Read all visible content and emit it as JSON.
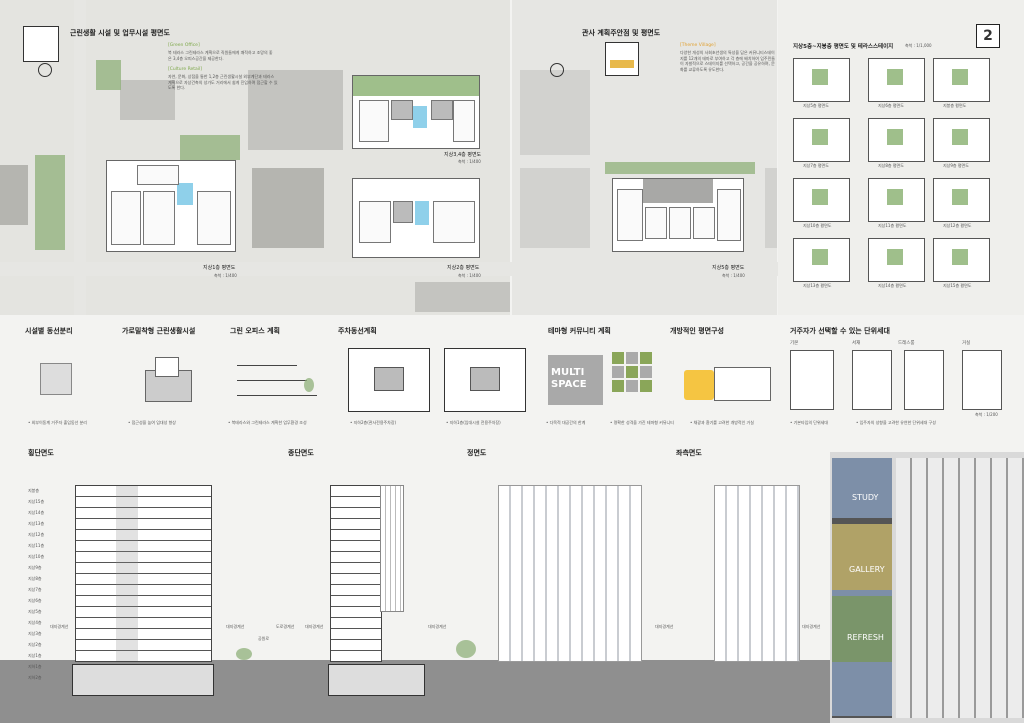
{
  "page_number": "2",
  "left_site": {
    "title": "근린생활 시설 및 업무시설 평면도",
    "green_office_tag": "[Green Office]",
    "green_office_text": "북 테라스 그린테라스 계획으로 직원들에게 쾌적하고 조망의 좋은 3,4층 오피스공간을 제공한다.",
    "culture_retail_tag": "[Culture Retail]",
    "culture_retail_text": "자연, 문화, 상점을 통한 1,2층 근린생활시설 외부계단과 테라스 계획으로 자상건축의 성가도 거리에서 쉽게 진입하며 접근할 수 있도록 한다.",
    "plan_1f_title": "지상1층 평면도",
    "plan_1f_scale": "축척 : 1/400",
    "plan_2f_title": "지상2층 평면도",
    "plan_2f_scale": "축척 : 1/400",
    "plan_34f_title": "지상3,4층 평면도",
    "plan_34f_scale": "축척 : 1/400"
  },
  "right_site": {
    "title": "관사 계획주안점 및 평면도",
    "theme_tag": "[Theme Village]",
    "theme_text": "다양한 개성의 사회초년생의 특성을 담은 커뮤니티스테이지를 12개의 테마로 부여하고 각 층에 배치하여 입주민들이 자발적으로 스테이지를 선택하고, 공간을 공유하며, 문화를 교류하도록 유도한다.",
    "plan_5f_title": "지상5층 평면도",
    "plan_5f_scale": "축척 : 1/400",
    "stage_title": "지상5층~지붕층 평면도 및 테라스스테이지",
    "stage_scale": "축척 : 1/1,000",
    "stages": [
      {
        "label": "지상5층 평면도"
      },
      {
        "label": "지상6층 평면도"
      },
      {
        "label": "지붕층 평면도"
      },
      {
        "label": "지상7층 평면도"
      },
      {
        "label": "지상8층 평면도"
      },
      {
        "label": "지상9층 평면도"
      },
      {
        "label": "지상10층 평면도"
      },
      {
        "label": "지상11층 평면도"
      },
      {
        "label": "지상12층 평면도"
      },
      {
        "label": "지상13층 평면도"
      },
      {
        "label": "지상14층 평면도"
      },
      {
        "label": "지상15층 평면도"
      }
    ]
  },
  "concepts_left": [
    {
      "title": "시설별 동선분리",
      "caption": "• 외부이동계 거주자 출입동선 분리"
    },
    {
      "title": "가로밀착형 근린생활시설",
      "caption": "• 접근성을 높여 임대성 향상"
    },
    {
      "title": "그린 오피스 계획",
      "caption": "• 북테라스와 그린테라스 계획한 업무환경 조성"
    },
    {
      "title": "주차동선계획",
      "caption": "• 지하2층(관사전용주차장)"
    },
    {
      "title": "",
      "caption": "• 지하1층(임대시설 전용주차장)"
    }
  ],
  "concepts_right": [
    {
      "title": "테마형 커뮤니티 계획",
      "caption": "• 다목적 대공간의 한계"
    },
    {
      "title": "",
      "caption": "• 명확한 성격을 가진 테마형 커뮤니티"
    },
    {
      "title": "개방적인 평면구성",
      "caption": "• 채광과 환기를 고려한 개방적인 거실"
    },
    {
      "title": "거주자가 선택할 수 있는 단위세대",
      "caption": "• 기본타입의 단위세대"
    },
    {
      "title": "",
      "caption": "• 입주자의 성향을 고려한 유연한 단위세대 구성"
    }
  ],
  "unit_labels": [
    "기본",
    "서재",
    "드레스룸",
    "거실"
  ],
  "unit_scale": "축척 : 1/200",
  "multi_space": "MULTI SPACE",
  "sections": {
    "cross": "횡단면도",
    "long": "종단면도",
    "front": "정면도",
    "left": "좌측면도",
    "road_boundary": "대지경계선",
    "park": "공원로",
    "road": "도로경계선"
  },
  "floor_levels": [
    "지붕층",
    "지상15층",
    "지상14층",
    "지상13층",
    "지상12층",
    "지상11층",
    "지상10층",
    "지상9층",
    "지상8층",
    "지상7층",
    "지상6층",
    "지상5층",
    "지상4층",
    "지상3층",
    "지상2층",
    "지상1층",
    "지하1층",
    "지하2층"
  ],
  "photo_labels": [
    "STUDY",
    "GALLERY",
    "REFRESH"
  ]
}
